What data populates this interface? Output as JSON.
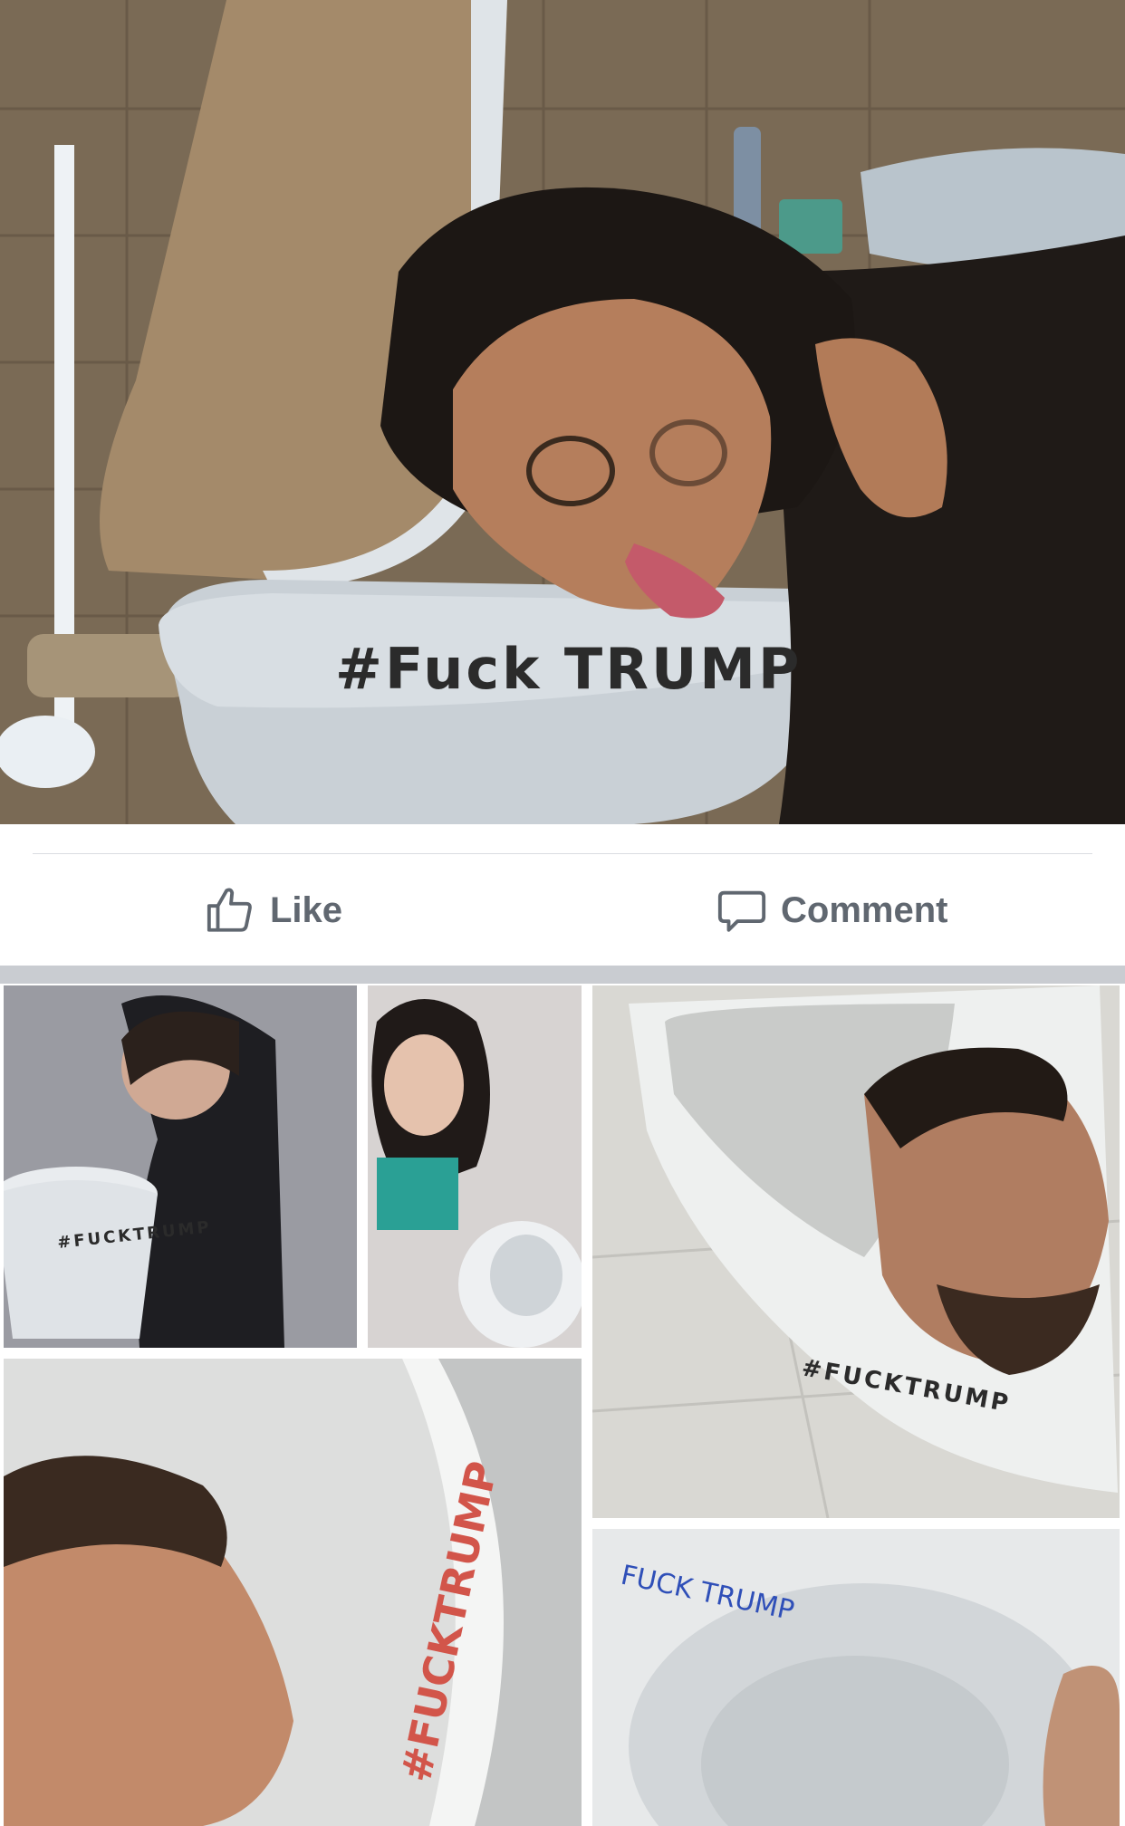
{
  "post": {
    "main_photo": {
      "alt": "Woman leaning into toilet bowl",
      "caption_on_seat": "#Fuck TRUMP"
    },
    "actions": {
      "like_label": "Like",
      "comment_label": "Comment",
      "like_icon": "thumbs-up-icon",
      "comment_icon": "speech-bubble-icon"
    },
    "collage": {
      "tiles": [
        {
          "name": "collage-photo-1",
          "writing": "#FUCKTRUMP"
        },
        {
          "name": "collage-photo-2",
          "writing": ""
        },
        {
          "name": "collage-photo-3",
          "writing": "#FUCKTRUMP"
        },
        {
          "name": "collage-photo-4",
          "writing": "#FUCKTRUMP"
        },
        {
          "name": "collage-photo-5",
          "writing": "FUCK TRUMP"
        }
      ]
    }
  },
  "colors": {
    "action_text": "#606770",
    "divider": "#dadde1",
    "band": "#c9ccd1"
  }
}
